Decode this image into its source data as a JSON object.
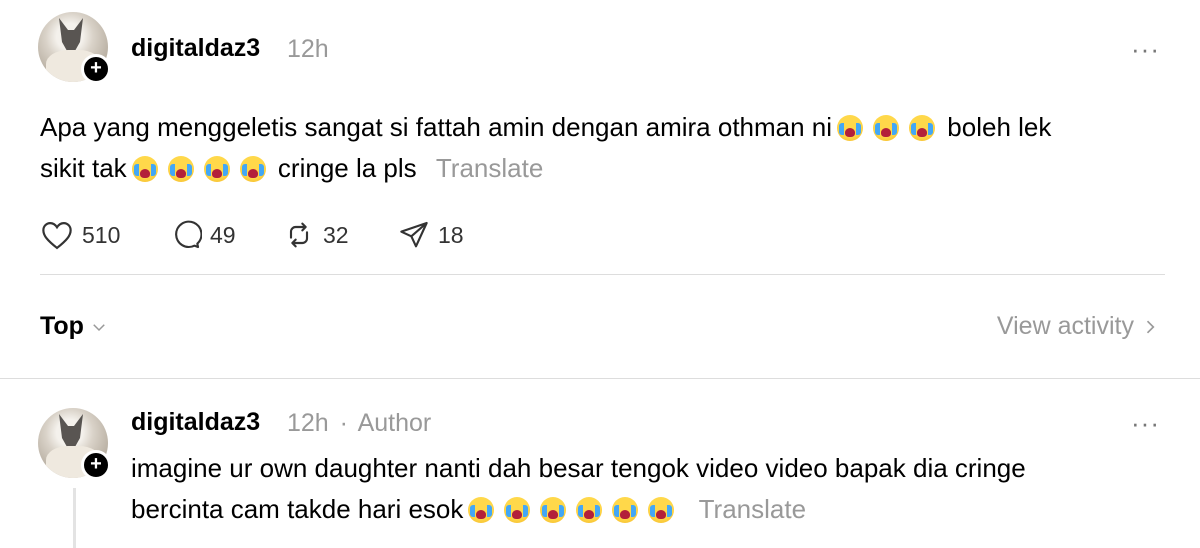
{
  "post": {
    "username": "digitaldaz3",
    "time": "12h",
    "more": "···",
    "text": "Apa yang menggeletis sangat si fattah amin dengan amira othman ni",
    "text_mid": "boleh lek",
    "text_line2": "sikit tak",
    "text_end": "cringe la pls",
    "translate": "Translate",
    "plus": "+"
  },
  "actions": {
    "likes": "510",
    "comments": "49",
    "reposts": "32",
    "shares": "18"
  },
  "sort": {
    "label": "Top",
    "view_activity": "View activity"
  },
  "reply": {
    "username": "digitaldaz3",
    "time": "12h",
    "separator": "·",
    "author": "Author",
    "more": "···",
    "line1": "imagine ur own daughter nanti dah besar tengok video video bapak dia cringe",
    "line2": "bercinta cam takde hari esok",
    "translate": "Translate",
    "plus": "+"
  },
  "emoji": {
    "name": "loudly-crying-face"
  }
}
